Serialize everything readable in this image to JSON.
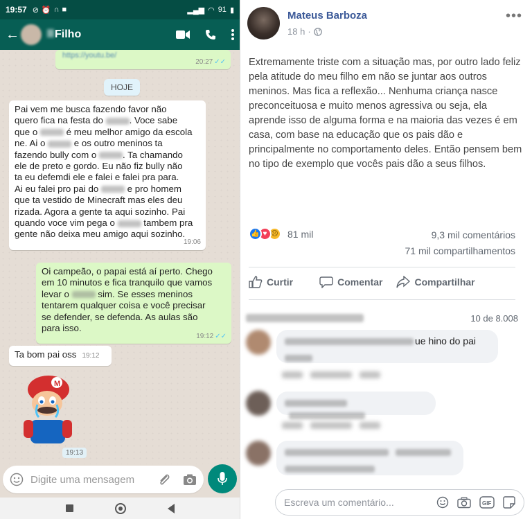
{
  "whatsapp": {
    "status_bar": {
      "time": "19:57",
      "battery": "91"
    },
    "header": {
      "contact_name": "Filho"
    },
    "link_message": {
      "text": "https://youtu.be/",
      "time": "20:27"
    },
    "date_chip": "HOJE",
    "messages": [
      {
        "direction": "in",
        "lines": [
          [
            "Pai vem me busca fazendo favor não"
          ],
          [
            "quero fica na festa do ",
            "•",
            ". Voce sabe"
          ],
          [
            "que o ",
            "•",
            " é meu melhor amigo da escola"
          ],
          [
            "ne. Ai o ",
            "•",
            " e os outro meninos ta"
          ],
          [
            "fazendo bully com o ",
            "•",
            ". Ta chamando"
          ],
          [
            "ele de preto e gordo. Eu não fiz bully não"
          ],
          [
            "ta eu defemdi ele e falei e falei pra para."
          ],
          [
            "Ai eu falei pro pai do ",
            "•",
            " e pro homem"
          ],
          [
            "que ta vestido de Minecraft mas eles deu"
          ],
          [
            "rizada. Agora a gente ta aqui sozinho. Pai"
          ],
          [
            "quando voce vim pega o ",
            "•",
            " tambem pra"
          ],
          [
            "gente não deixa meu amigo aqui sozinho."
          ]
        ],
        "time": "19:06"
      },
      {
        "direction": "out",
        "lines": [
          [
            "Oi campeão, o papai está aí perto. Chego"
          ],
          [
            "em 10 minutos e fica tranquilo que vamos"
          ],
          [
            "levar o ",
            "•",
            " sim. Se esses meninos"
          ],
          [
            "tentarem qualquer coisa e você precisar"
          ],
          [
            "se defender, se defenda. As aulas são"
          ],
          [
            "para isso."
          ]
        ],
        "time": "19:12"
      },
      {
        "direction": "in",
        "text": "Ta bom pai oss",
        "time": "19:12"
      }
    ],
    "sticker": {
      "name": "crying-mario-sticker",
      "time": "19:13"
    },
    "input": {
      "placeholder": "Digite uma mensagem"
    }
  },
  "facebook": {
    "author": "Mateus Barboza",
    "meta_time": "18 h",
    "post_text": "Extremamente triste com a situação mas, por outro lado feliz pela atitude do meu filho em não se juntar aos outros meninos. Mas fica a reflexão... Nenhuma criança nasce preconceituosa e muito menos agressiva ou seja, ela aprende isso de alguma forma e na maioria das vezes é em casa, com base na educação que os pais dão e principalmente no comportamento deles. Então pensem bem no tipo de exemplo que vocês pais dão a seus filhos.",
    "reactions_count": "81 mil",
    "comments_count": "9,3 mil comentários",
    "shares_count": "71 mil compartilhamentos",
    "actions": {
      "like": "Curtir",
      "comment": "Comentar",
      "share": "Compartilhar"
    },
    "pagination": "10 de 8.008",
    "comments": [
      {
        "visible_text": "ue hino do pai"
      },
      {
        "visible_text": ""
      },
      {
        "visible_text": ""
      }
    ],
    "compose_placeholder": "Escreva um comentário..."
  }
}
